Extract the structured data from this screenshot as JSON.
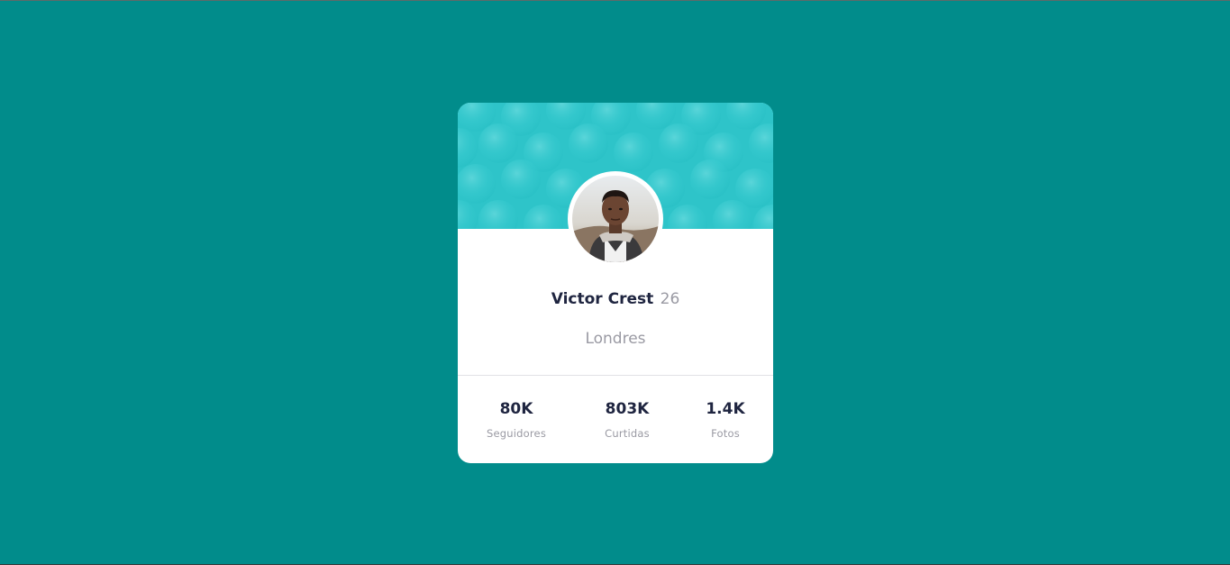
{
  "profile": {
    "name": "Victor Crest",
    "age": "26",
    "location": "Londres"
  },
  "stats": [
    {
      "value": "80K",
      "label": "Seguidores"
    },
    {
      "value": "803K",
      "label": "Curtidas"
    },
    {
      "value": "1.4K",
      "label": "Fotos"
    }
  ],
  "colors": {
    "background": "#018c8b",
    "header_pattern": "#2ec4c9",
    "card": "#ffffff",
    "text_dark": "#1f2540",
    "text_muted": "#9a9aa3"
  }
}
